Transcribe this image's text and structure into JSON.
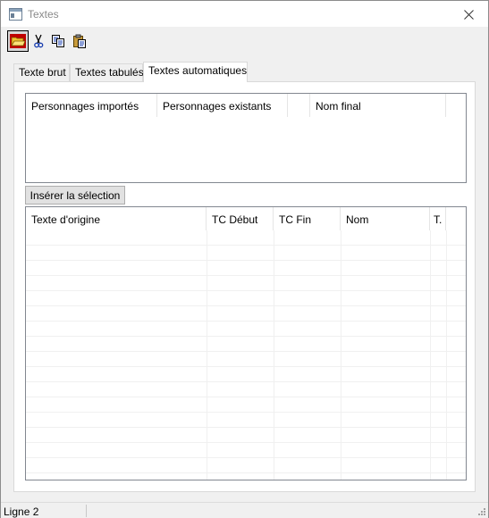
{
  "window": {
    "title": "Textes"
  },
  "toolbar": {
    "buttons": [
      {
        "icon": "open-folder-icon",
        "pressed": true
      },
      {
        "icon": "cut-icon"
      },
      {
        "icon": "copy-icon"
      },
      {
        "icon": "paste-icon"
      }
    ]
  },
  "tabs": [
    {
      "label": "Texte brut"
    },
    {
      "label": "Textes tabulés"
    },
    {
      "label": "Textes automatiques",
      "active": true
    }
  ],
  "characters_table": {
    "columns": [
      "Personnages importés",
      "Personnages existants",
      "",
      "Nom final"
    ]
  },
  "insert_button": {
    "label": "Insérer la sélection"
  },
  "texts_table": {
    "columns": [
      "Texte d'origine",
      "TC Début",
      "TC Fin",
      "Nom",
      "T."
    ]
  },
  "status": {
    "text": "Ligne 2"
  },
  "colors": {
    "window_bg": "#f0f0f0",
    "panel_bg": "#ffffff",
    "border": "#828790"
  }
}
